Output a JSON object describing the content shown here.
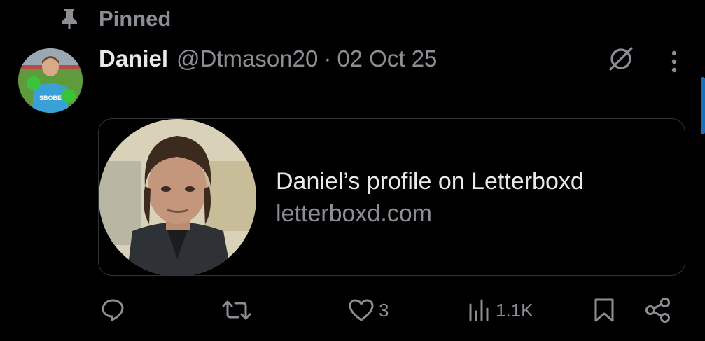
{
  "pinned": {
    "label": "Pinned"
  },
  "post": {
    "author_name": "Daniel",
    "handle": "@Dtmason20",
    "separator": "·",
    "date": "02 Oct 25"
  },
  "link_card": {
    "title": "Daniel’s profile on Letterboxd",
    "domain": "letterboxd.com"
  },
  "avatar_jersey_text": "SBOBE",
  "actions": {
    "likes": "3",
    "views": "1.1K"
  },
  "colors": {
    "background": "#000000",
    "primary_text": "#e7e9ea",
    "secondary_text": "#8b8f94",
    "border": "#2f3336",
    "scrollbar": "#1d6fb8"
  },
  "icons": {
    "pin": "pin-icon",
    "grok": "grok-icon",
    "more": "more-icon",
    "reply": "reply-icon",
    "repost": "repost-icon",
    "like": "heart-icon",
    "views": "views-icon",
    "bookmark": "bookmark-icon",
    "share": "share-icon"
  }
}
